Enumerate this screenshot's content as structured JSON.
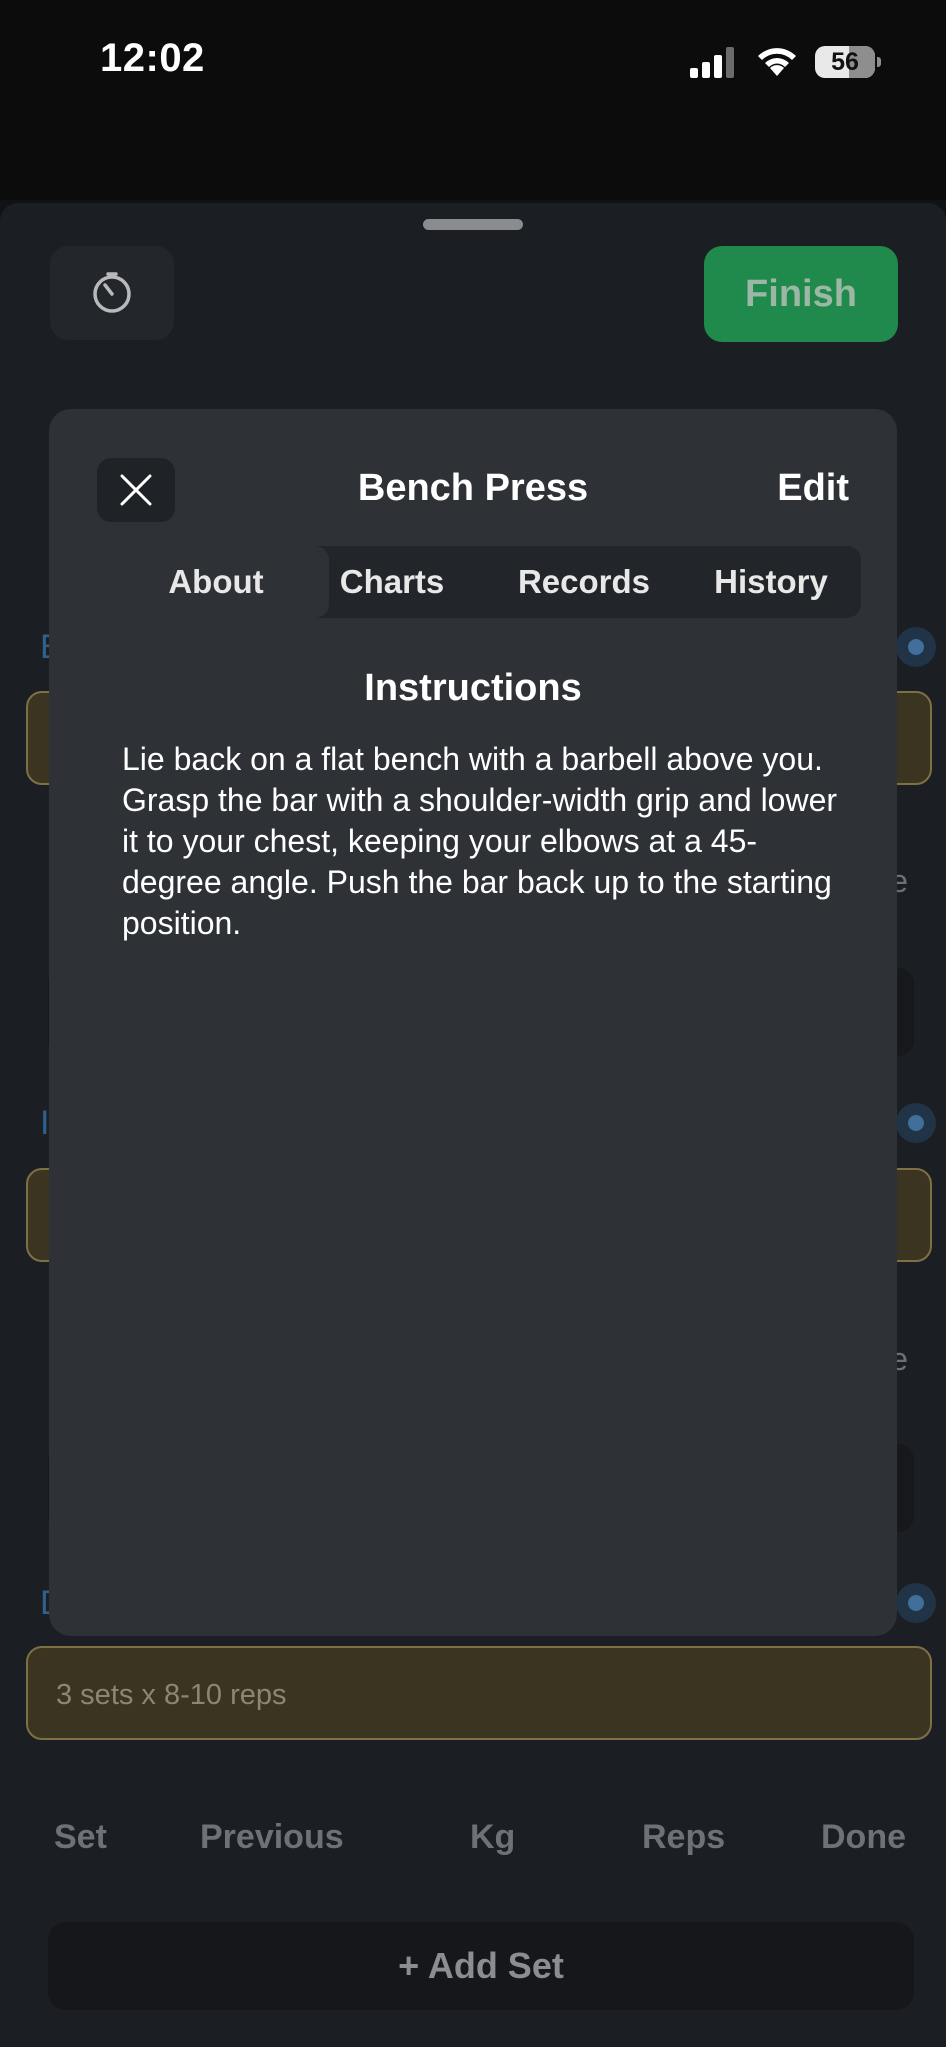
{
  "status_bar": {
    "time": "12:02",
    "battery": "56"
  },
  "workout": {
    "finish_label": "Finish",
    "note_placeholder": "3 sets x 8-10 reps",
    "columns": [
      "Set",
      "Previous",
      "Kg",
      "Reps",
      "Done"
    ],
    "add_set_label": "+ Add Set",
    "partial_letters": [
      "E",
      "I",
      "D"
    ],
    "partial_edge_text": [
      "e",
      "e"
    ]
  },
  "modal": {
    "title": "Bench Press",
    "edit_label": "Edit",
    "tabs": [
      {
        "label": "About",
        "active": true
      },
      {
        "label": "Charts",
        "active": false
      },
      {
        "label": "Records",
        "active": false
      },
      {
        "label": "History",
        "active": false
      }
    ],
    "section_title": "Instructions",
    "instructions": "Lie back on a flat bench with a barbell above you. Grasp the bar with a shoulder-width grip and lower it to your chest, keeping your elbows at a 45-degree angle. Push the bar back up to the starting position."
  },
  "icons": {
    "timer": "timer-icon",
    "close": "close-icon",
    "signal": "cellular-signal-icon",
    "wifi": "wifi-icon",
    "battery": "battery-icon"
  },
  "colors": {
    "finish_green": "#1f8a4c",
    "modal_bg": "#2e3136",
    "note_bg": "#3b3420",
    "accent_blue": "#2f5f8c"
  }
}
